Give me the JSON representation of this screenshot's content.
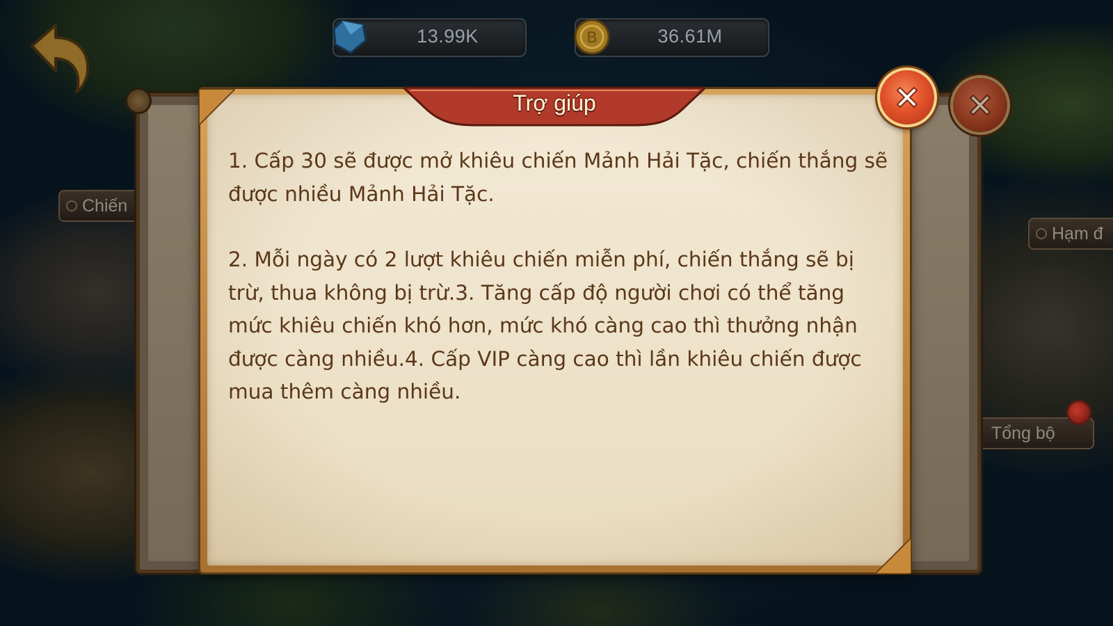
{
  "resources": {
    "gems": "13.99K",
    "gold": "36.61M"
  },
  "map_labels": {
    "left": "Chiến",
    "right": "Hạm đ",
    "hq": "Tổng bộ"
  },
  "dialog": {
    "title": "Trợ giúp",
    "paragraph_1": "1. Cấp 30 sẽ được mở khiêu chiến Mảnh Hải Tặc, chiến thắng sẽ được nhiều Mảnh Hải Tặc.",
    "paragraph_2": "2. Mỗi ngày có 2 lượt khiêu chiến miễn phí, chiến thắng sẽ bị trừ, thua không bị trừ.3. Tăng cấp độ người chơi có thể tăng mức khiêu chiến khó hơn, mức khó càng cao thì thưởng nhận được càng nhiều.4. Cấp VIP càng cao thì lần khiêu chiến được mua thêm càng nhiều."
  },
  "icons": {
    "back": "back-arrow-icon",
    "gem": "gem-icon",
    "coin": "gold-coin-icon",
    "close": "close-x-icon"
  },
  "colors": {
    "title_ribbon": "#b23a2a",
    "paper": "#efe4cc",
    "text": "#5b3719",
    "frame": "#c58a40",
    "close_button": "#e2522a"
  }
}
